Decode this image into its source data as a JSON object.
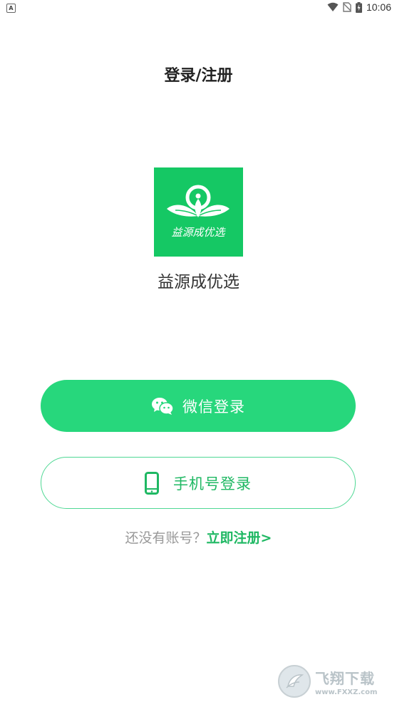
{
  "status_bar": {
    "notification_glyph": "A",
    "time": "10:06"
  },
  "header": {
    "title": "登录/注册"
  },
  "app": {
    "logo_text": "益源成优选",
    "name": "益源成优选",
    "brand_color": "#15c864"
  },
  "buttons": {
    "wechat_login": "微信登录",
    "phone_login": "手机号登录"
  },
  "register": {
    "prompt": "还没有账号？",
    "link": "立即注册>"
  },
  "watermark": {
    "title": "飞翔下载",
    "url": "www.FXXZ.com"
  },
  "colors": {
    "primary_green": "#27d77c",
    "link_green": "#1fb863",
    "prompt_gray": "#999999"
  }
}
